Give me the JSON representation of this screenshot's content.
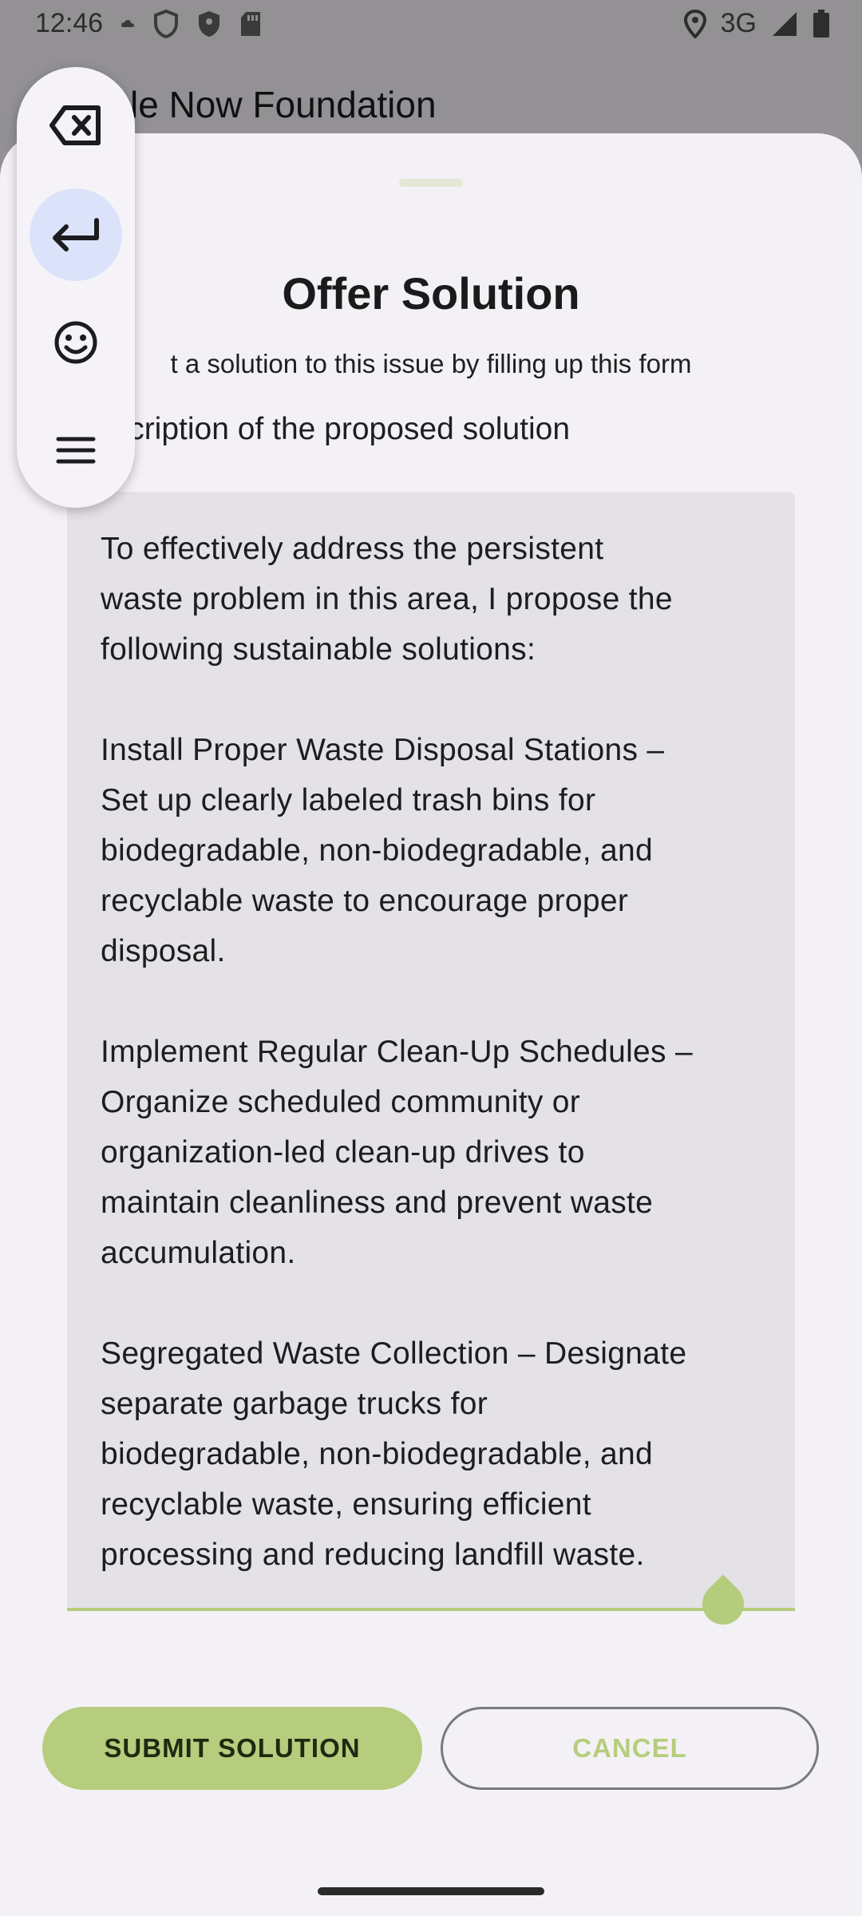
{
  "status_bar": {
    "time": "12:46",
    "left_icons": [
      "cloud-icon",
      "shield-icon",
      "shield-filled-icon",
      "sd-card-icon"
    ],
    "network": "3G",
    "right_icons": [
      "location-icon",
      "signal-icon",
      "battery-icon"
    ]
  },
  "background_app": {
    "title": "cle Now Foundation"
  },
  "sheet": {
    "title": "Offer Solution",
    "subtitle": "t a solution to this issue by filling up this form",
    "field_label": "escription of the proposed solution",
    "textarea_value": "To effectively address the persistent\nwaste problem in this area, I propose the\nfollowing sustainable solutions:\n\nInstall Proper Waste Disposal Stations –\nSet up clearly labeled trash bins for\nbiodegradable, non-biodegradable, and\nrecyclable waste to encourage proper\ndisposal.\n\nImplement Regular Clean-Up Schedules –\nOrganize scheduled community or\norganization-led clean-up drives to\nmaintain cleanliness and prevent waste\naccumulation.\n\nSegregated Waste Collection – Designate\nseparate garbage trucks for\nbiodegradable, non-biodegradable, and\nrecyclable waste, ensuring efficient\nprocessing and reducing landfill waste."
  },
  "buttons": {
    "submit_label": "SUBMIT SOLUTION",
    "cancel_label": "CANCEL"
  },
  "floating_toolbar": {
    "items": [
      "backspace-icon",
      "enter-icon",
      "emoji-icon",
      "menu-icon"
    ],
    "active_item": "enter-icon"
  },
  "colors": {
    "accent": "#b6cd7d",
    "sheet_bg": "#f4f1f6",
    "field_bg": "#e4e1e7",
    "toolbar_active": "#dbe3fb"
  }
}
